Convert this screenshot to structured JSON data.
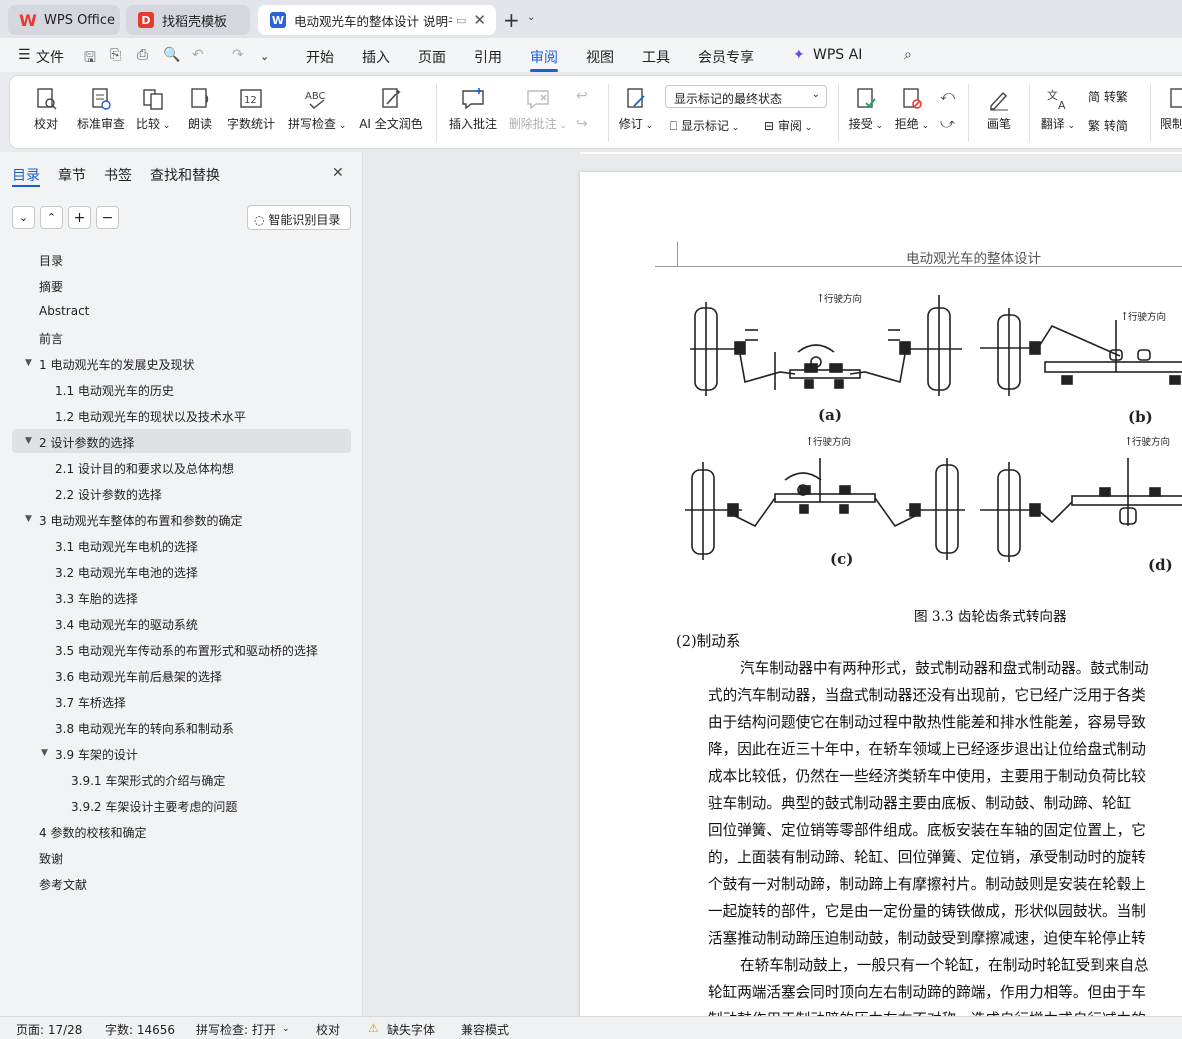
{
  "tabs": [
    {
      "label": "WPS Office"
    },
    {
      "label": "找稻壳模板"
    },
    {
      "label": "电动观光车的整体设计 说明书"
    }
  ],
  "menu": {
    "file": "文件",
    "items": [
      "开始",
      "插入",
      "页面",
      "引用",
      "审阅",
      "视图",
      "工具",
      "会员专享"
    ],
    "ai": "WPS AI"
  },
  "ribbon": {
    "proofread": "校对",
    "std_review": "标准审查",
    "compare": "比较",
    "read_aloud": "朗读",
    "word_count": "字数统计",
    "spell_check": "拼写检查",
    "ai_polish": "AI 全文润色",
    "insert_comment": "插入批注",
    "delete_comment": "删除批注",
    "track_changes": "修订",
    "show_markup_state": "显示标记的最终状态",
    "show_markup": "显示标记",
    "review": "审阅",
    "accept": "接受",
    "reject": "拒绝",
    "pen": "画笔",
    "translate": "翻译",
    "to_trad": "简 转繁",
    "to_simp": "繁 转简",
    "restrict": "限制"
  },
  "sidebar": {
    "tabs": [
      "目录",
      "章节",
      "书签",
      "查找和替换"
    ],
    "smart_toc": "智能识别目录",
    "toc": [
      {
        "label": "目录",
        "level": 0
      },
      {
        "label": "摘要",
        "level": 0
      },
      {
        "label": "Abstract",
        "level": 0
      },
      {
        "label": "前言",
        "level": 0
      },
      {
        "label": "1  电动观光车的发展史及现状",
        "level": 0,
        "expand": true
      },
      {
        "label": "1.1 电动观光车的历史",
        "level": 1
      },
      {
        "label": "1.2  电动观光车的现状以及技术水平",
        "level": 1
      },
      {
        "label": "2 设计参数的选择",
        "level": 0,
        "expand": true,
        "selected": true
      },
      {
        "label": "2.1    设计目的和要求以及总体构想",
        "level": 1
      },
      {
        "label": "2.2 设计参数的选择",
        "level": 1
      },
      {
        "label": "3  电动观光车整体的布置和参数的确定",
        "level": 0,
        "expand": true
      },
      {
        "label": "3.1 电动观光车电机的选择",
        "level": 1
      },
      {
        "label": "3.2 电动观光车电池的选择",
        "level": 1
      },
      {
        "label": "3.3  车胎的选择",
        "level": 1
      },
      {
        "label": "3.4 电动观光车的驱动系统",
        "level": 1
      },
      {
        "label": "3.5  电动观光车传动系的布置形式和驱动桥的选择",
        "level": 1
      },
      {
        "label": "3.6  电动观光车前后悬架的选择",
        "level": 1
      },
      {
        "label": "3.7  车桥选择",
        "level": 1
      },
      {
        "label": "3.8  电动观光车的转向系和制动系",
        "level": 1
      },
      {
        "label": "3.9 车架的设计",
        "level": 1,
        "expand": true
      },
      {
        "label": "3.9.1 车架形式的介绍与确定",
        "level": 2
      },
      {
        "label": "3.9.2 车架设计主要考虑的问题",
        "level": 2
      },
      {
        "label": "4  参数的校核和确定",
        "level": 0
      },
      {
        "label": "致谢",
        "level": 0
      },
      {
        "label": "参考文献",
        "level": 0
      }
    ]
  },
  "doc": {
    "header": "电动观光车的整体设计",
    "fig_direction": "行驶方向",
    "fig_labels": [
      "(a)",
      "(b)",
      "(c)",
      "(d)"
    ],
    "caption": "图 3.3  齿轮齿条式转向器",
    "section": "(2)制动系",
    "lines": [
      "汽车制动器中有两种形式，鼓式制动器和盘式制动器。鼓式制动",
      "式的汽车制动器，当盘式制动器还没有出现前，它已经广泛用于各类",
      "由于结构问题使它在制动过程中散热性能差和排水性能差，容易导致",
      "降，因此在近三十年中，在轿车领域上已经逐步退出让位给盘式制动",
      "成本比较低，仍然在一些经济类轿车中使用，主要用于制动负荷比较",
      "驻车制动。典型的鼓式制动器主要由底板、制动鼓、制动蹄、轮缸",
      "回位弹簧、定位销等零部件组成。底板安装在车轴的固定位置上，它",
      "的，上面装有制动蹄、轮缸、回位弹簧、定位销，承受制动时的旋转",
      "个鼓有一对制动蹄，制动蹄上有摩擦衬片。制动鼓则是安装在轮毂上",
      "一起旋转的部件，它是由一定份量的铸铁做成，形状似园鼓状。当制",
      "活塞推动制动蹄压迫制动鼓，制动鼓受到摩擦减速，迫使车轮停止转",
      "在轿车制动鼓上，一般只有一个轮缸，在制动时轮缸受到来自总",
      "轮缸两端活塞会同时顶向左右制动蹄的蹄端，作用力相等。但由于车",
      "制动鼓作用于制动蹄的压力左右不对称，造成自行增力或自行减力的"
    ]
  },
  "status": {
    "page": "页面: 17/28",
    "words": "字数: 14656",
    "spell": "拼写检查: 打开",
    "proof": "校对",
    "missing_font": "缺失字体",
    "compat": "兼容模式"
  },
  "colors": {
    "accent": "#1b5fd6",
    "wps_red": "#e8382f"
  }
}
